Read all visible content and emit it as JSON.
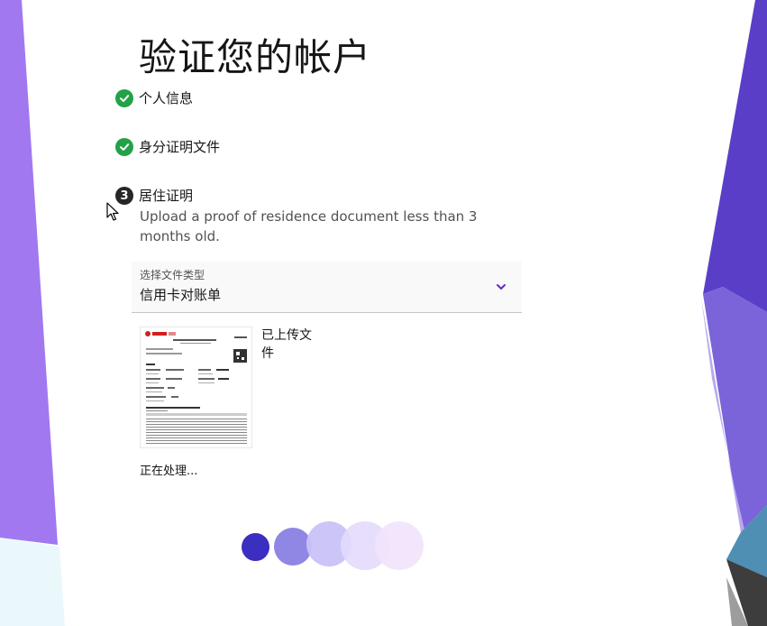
{
  "page": {
    "title": "验证您的帐户"
  },
  "steps": [
    {
      "label": "个人信息",
      "status": "completed",
      "icon": "checkmark-icon"
    },
    {
      "label": "身分证明文件",
      "status": "completed",
      "icon": "checkmark-icon"
    },
    {
      "number": "3",
      "label": "居住证明",
      "status": "current",
      "description": "Upload a proof of residence document less than 3 months old."
    }
  ],
  "document_type": {
    "label": "选择文件类型",
    "selected": "信用卡对账单",
    "icon": "chevron-down-icon"
  },
  "upload": {
    "status_text": "已上传文件",
    "thumbnail_icon": "document-preview-icon"
  },
  "processing": {
    "text": "正在处理..."
  },
  "colors": {
    "accent": "#6929c4",
    "success": "#24a148",
    "dot1": "#3a2fc0",
    "dot2": "#8f87e3",
    "dot3": "#c9c2f7",
    "dot4": "#e3dafb",
    "dot5": "#f1e3fc"
  }
}
